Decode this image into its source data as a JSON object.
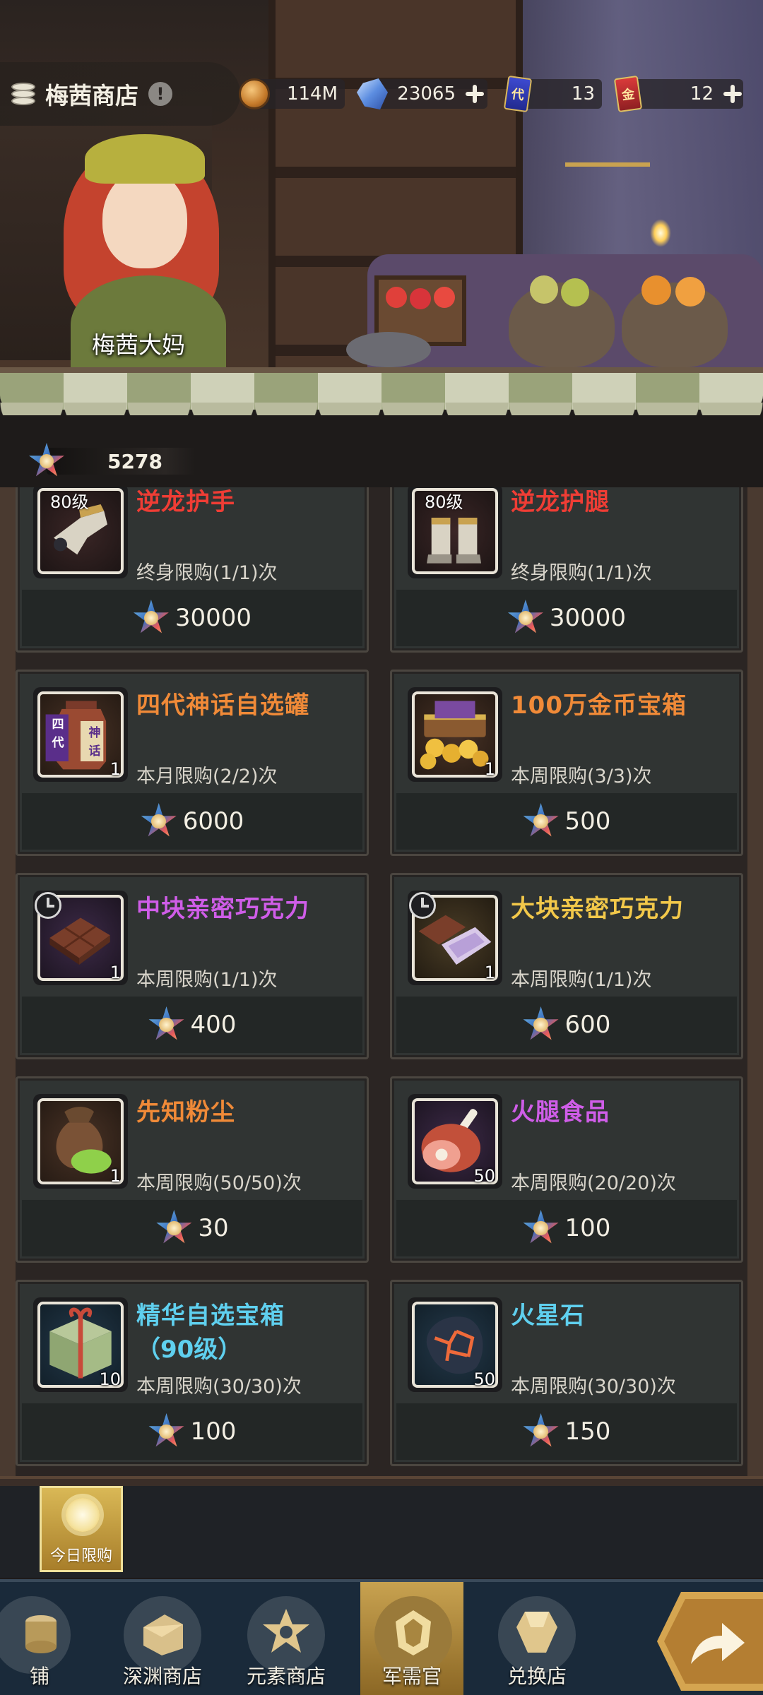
{
  "header": {
    "title": "梅茜商店",
    "info_glyph": "!",
    "shopkeeper_name": "梅茜大妈",
    "resources": [
      {
        "icon": "gold-coin-icon",
        "value": "114M",
        "has_plus": false
      },
      {
        "icon": "crystal-icon",
        "value": "23065",
        "has_plus": true
      },
      {
        "icon": "blue-card-icon",
        "glyph": "代",
        "value": "13",
        "has_plus": false
      },
      {
        "icon": "red-card-icon",
        "glyph": "金",
        "value": "12",
        "has_plus": true
      }
    ]
  },
  "currency": {
    "icon": "military-medal-icon",
    "value": "5278"
  },
  "items": [
    {
      "name": "逆龙护手",
      "name_line2": "",
      "level": "80级",
      "limit": "终身限购(1/1)次",
      "price": "30000",
      "qty": "",
      "rarity": "red",
      "timed": false,
      "icon": "gauntlet-icon"
    },
    {
      "name": "逆龙护腿",
      "name_line2": "",
      "level": "80级",
      "limit": "终身限购(1/1)次",
      "price": "30000",
      "qty": "",
      "rarity": "red",
      "timed": false,
      "icon": "greaves-icon"
    },
    {
      "name": "四代神话自选罐",
      "name_line2": "",
      "level": "",
      "limit": "本月限购(2/2)次",
      "price": "6000",
      "qty": "1",
      "rarity": "orange",
      "timed": false,
      "icon": "myth-jar-icon",
      "jar_labels": [
        "四",
        "代",
        "神",
        "话"
      ]
    },
    {
      "name": "100万金币宝箱",
      "name_line2": "",
      "level": "",
      "limit": "本周限购(3/3)次",
      "price": "500",
      "qty": "1",
      "rarity": "orange",
      "timed": false,
      "icon": "gold-chest-icon"
    },
    {
      "name": "中块亲密巧克力",
      "name_line2": "",
      "level": "",
      "limit": "本周限购(1/1)次",
      "price": "400",
      "qty": "1",
      "rarity": "purple",
      "timed": true,
      "icon": "chocolate-icon"
    },
    {
      "name": "大块亲密巧克力",
      "name_line2": "",
      "level": "",
      "limit": "本周限购(1/1)次",
      "price": "600",
      "qty": "1",
      "rarity": "gold",
      "timed": true,
      "icon": "chocolate-box-icon"
    },
    {
      "name": "先知粉尘",
      "name_line2": "",
      "level": "",
      "limit": "本周限购(50/50)次",
      "price": "30",
      "qty": "1",
      "rarity": "orange",
      "timed": false,
      "icon": "dust-bag-icon"
    },
    {
      "name": "火腿食品",
      "name_line2": "",
      "level": "",
      "limit": "本周限购(20/20)次",
      "price": "100",
      "qty": "50",
      "rarity": "purple",
      "timed": false,
      "icon": "ham-icon"
    },
    {
      "name": "精华自选宝箱",
      "name_line2": "（90级）",
      "level": "",
      "limit": "本周限购(30/30)次",
      "price": "100",
      "qty": "10",
      "rarity": "blue",
      "timed": false,
      "icon": "essence-chest-icon"
    },
    {
      "name": "火星石",
      "name_line2": "",
      "level": "",
      "limit": "本周限购(30/30)次",
      "price": "150",
      "qty": "50",
      "rarity": "blue",
      "timed": false,
      "icon": "mars-stone-icon"
    }
  ],
  "daily": {
    "label": "今日限购"
  },
  "nav": [
    {
      "label": "铺",
      "icon": "shop-icon",
      "active": false
    },
    {
      "label": "深渊商店",
      "icon": "abyss-shop-icon",
      "active": false
    },
    {
      "label": "元素商店",
      "icon": "element-shop-icon",
      "active": false
    },
    {
      "label": "军需官",
      "icon": "quartermaster-icon",
      "active": true
    },
    {
      "label": "兑换店",
      "icon": "exchange-shop-icon",
      "active": false
    }
  ],
  "colors": {
    "red": "#ef3d35",
    "orange": "#f08a38",
    "purple": "#cf5de8",
    "gold": "#f2c84a",
    "blue": "#5fd0ef"
  }
}
